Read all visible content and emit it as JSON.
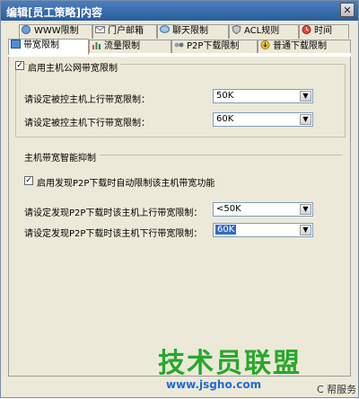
{
  "window": {
    "title": "编辑[员工策略]内容",
    "close_label": "✕"
  },
  "tabs_back": [
    {
      "label": "WWW限制",
      "icon": "globe-icon"
    },
    {
      "label": "门户邮箱",
      "icon": "mail-icon"
    },
    {
      "label": "聊天限制",
      "icon": "chat-icon"
    },
    {
      "label": "ACL规则",
      "icon": "shield-icon"
    },
    {
      "label": "时间",
      "icon": "clock-icon"
    }
  ],
  "tabs_front": [
    {
      "label": "带宽限制",
      "icon": "bandwidth-icon"
    },
    {
      "label": "流量限制",
      "icon": "chart-icon"
    },
    {
      "label": "P2P下载限制",
      "icon": "p2p-icon"
    },
    {
      "label": "普通下载限制",
      "icon": "download-icon"
    }
  ],
  "enable_public_limit": {
    "label": "启用主机公网带宽限制",
    "checked": true
  },
  "upload_limit": {
    "label": "请设定被控主机上行带宽限制：",
    "value": "50K"
  },
  "download_limit": {
    "label": "请设定被控主机下行带宽限制：",
    "value": "60K"
  },
  "smart_section": {
    "label": "主机带宽智能抑制"
  },
  "auto_suppress": {
    "label": "启用发现P2P下载时自动限制该主机带宽功能",
    "checked": true
  },
  "p2p_upload_limit": {
    "label": "请设定发现P2P下载时该主机上行带宽限制：",
    "value": "<50K"
  },
  "p2p_download_limit": {
    "label": "请设定发现P2P下载时该主机下行带宽限制：",
    "value": "60K"
  },
  "watermark": {
    "text": "技术员联盟",
    "url": "www.jsgho.com",
    "suffix": "C 帮服务"
  }
}
